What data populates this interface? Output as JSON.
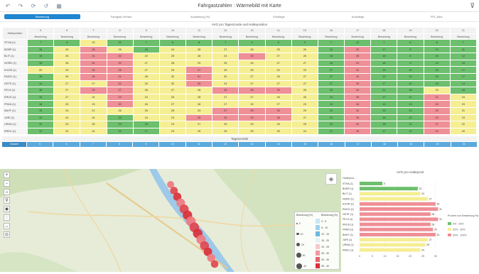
{
  "toolbar": {
    "title": "Fahrgastzahlen : Wärmebild mit Karte"
  },
  "tabs": [
    "Bewertung",
    "Fahrgast-Verlauf",
    "Auslastung (%)",
    "Einstiege",
    "Ausstiege",
    "FPL-Abw."
  ],
  "grid": {
    "title": "AVG pro Tageszonde und Halteposition",
    "corner_label": "Halteposition",
    "hours": [
      "5",
      "6",
      "7",
      "8",
      "9",
      "10",
      "11",
      "12",
      "13",
      "14",
      "15",
      "16",
      "17",
      "18",
      "19",
      "20",
      "21"
    ],
    "sub_label": "Bewertung",
    "rows": [
      {
        "label": "STHA (1)",
        "cells": [
          [
            "7",
            "g"
          ],
          [
            "6",
            "g"
          ],
          [
            "23",
            "y"
          ],
          [
            "21",
            "g"
          ],
          [
            "7",
            "g"
          ],
          [
            "8",
            "g"
          ],
          [
            "8",
            "g"
          ],
          [
            "7",
            "g"
          ],
          [
            "9",
            "g"
          ],
          [
            "8",
            "g"
          ],
          [
            "9",
            "g"
          ],
          [
            "7",
            "g"
          ],
          [
            "12",
            "g"
          ],
          [
            "7",
            "g"
          ],
          [
            "6",
            "g"
          ],
          [
            "8",
            "g"
          ],
          [
            "7",
            "g"
          ]
        ]
      },
      {
        "label": "BOBP (1)",
        "cells": [
          [
            "16",
            "g"
          ],
          [
            "29",
            "y"
          ],
          [
            "28",
            "r"
          ],
          [
            "26",
            "y"
          ],
          [
            "18",
            "g"
          ],
          [
            "24",
            "y"
          ],
          [
            "28",
            "y"
          ],
          [
            "27",
            "y"
          ],
          [
            "26",
            "y"
          ],
          [
            "25",
            "y"
          ],
          [
            "26",
            "y"
          ],
          [
            "10",
            "g"
          ],
          [
            "32",
            "r"
          ],
          [
            "17",
            "g"
          ],
          [
            "6",
            "g"
          ],
          [
            "13",
            "g"
          ],
          [
            "11",
            "g"
          ]
        ]
      },
      {
        "label": "BLIT (1)",
        "cells": [
          [
            "15",
            "g"
          ],
          [
            "25",
            "y"
          ],
          [
            "31",
            "r"
          ],
          [
            "32",
            "r"
          ],
          [
            "22",
            "y"
          ],
          [
            "25",
            "y"
          ],
          [
            "28",
            "y"
          ],
          [
            "24",
            "y"
          ],
          [
            "33",
            "r"
          ],
          [
            "27",
            "y"
          ],
          [
            "28",
            "y"
          ],
          [
            "16",
            "g"
          ],
          [
            "28",
            "r"
          ],
          [
            "18",
            "g"
          ],
          [
            "8",
            "g"
          ],
          [
            "16",
            "g"
          ],
          [
            "12",
            "g"
          ]
        ]
      },
      {
        "label": "NORD (1)",
        "cells": [
          [
            "15",
            "g"
          ],
          [
            "28",
            "y"
          ],
          [
            "31",
            "r"
          ],
          [
            "32",
            "r"
          ],
          [
            "27",
            "y"
          ],
          [
            "28",
            "y"
          ],
          [
            "29",
            "y"
          ],
          [
            "25",
            "y"
          ],
          [
            "26",
            "y"
          ],
          [
            "27",
            "y"
          ],
          [
            "27",
            "y"
          ],
          [
            "15",
            "g"
          ],
          [
            "31",
            "r"
          ],
          [
            "18",
            "g"
          ],
          [
            "9",
            "g"
          ],
          [
            "19",
            "g"
          ],
          [
            "15",
            "g"
          ]
        ]
      },
      {
        "label": "KOOR (1)",
        "cells": [
          [
            "20",
            "y"
          ],
          [
            "29",
            "y"
          ],
          [
            "33",
            "r"
          ],
          [
            "28",
            "r"
          ],
          [
            "27",
            "y"
          ],
          [
            "26",
            "y"
          ],
          [
            "27",
            "r"
          ],
          [
            "28",
            "y"
          ],
          [
            "28",
            "y"
          ],
          [
            "32",
            "y"
          ],
          [
            "23",
            "y"
          ],
          [
            "27",
            "g"
          ],
          [
            "31",
            "r"
          ],
          [
            "18",
            "g"
          ],
          [
            "10",
            "g"
          ],
          [
            "18",
            "g"
          ],
          [
            "17",
            "g"
          ]
        ]
      },
      {
        "label": "RUDO (1)",
        "cells": [
          [
            "18",
            "g"
          ],
          [
            "30",
            "y"
          ],
          [
            "33",
            "r"
          ],
          [
            "31",
            "r"
          ],
          [
            "28",
            "y"
          ],
          [
            "32",
            "y"
          ],
          [
            "31",
            "r"
          ],
          [
            "30",
            "y"
          ],
          [
            "27",
            "y"
          ],
          [
            "26",
            "y"
          ],
          [
            "27",
            "y"
          ],
          [
            "27",
            "g"
          ],
          [
            "33",
            "r"
          ],
          [
            "19",
            "g"
          ],
          [
            "10",
            "g"
          ],
          [
            "25",
            "g"
          ],
          [
            "17",
            "g"
          ]
        ]
      },
      {
        "label": "GETE (1)",
        "cells": [
          [
            "14",
            "g"
          ],
          [
            "27",
            "y"
          ],
          [
            "27",
            "y"
          ],
          [
            "32",
            "r"
          ],
          [
            "26",
            "y"
          ],
          [
            "32",
            "y"
          ],
          [
            "33",
            "r"
          ],
          [
            "24",
            "y"
          ],
          [
            "27",
            "y"
          ],
          [
            "27",
            "y"
          ],
          [
            "27",
            "y"
          ],
          [
            "27",
            "g"
          ],
          [
            "33",
            "r"
          ],
          [
            "17",
            "g"
          ],
          [
            "10",
            "g"
          ],
          [
            "18",
            "g"
          ],
          [
            "14",
            "g"
          ]
        ]
      },
      {
        "label": "FELS (1)",
        "cells": [
          [
            "18",
            "g"
          ],
          [
            "27",
            "y"
          ],
          [
            "33",
            "r"
          ],
          [
            "27",
            "r"
          ],
          [
            "28",
            "y"
          ],
          [
            "27",
            "y"
          ],
          [
            "28",
            "y"
          ],
          [
            "33",
            "r"
          ],
          [
            "36",
            "r"
          ],
          [
            "33",
            "r"
          ],
          [
            "26",
            "y"
          ],
          [
            "25",
            "g"
          ],
          [
            "34",
            "r"
          ],
          [
            "21",
            "g"
          ],
          [
            "16",
            "g"
          ],
          [
            "23",
            "y"
          ],
          [
            "18",
            "g"
          ]
        ]
      },
      {
        "label": "KRUS (1)",
        "cells": [
          [
            "16",
            "g"
          ],
          [
            "27",
            "y"
          ],
          [
            "24",
            "y"
          ],
          [
            "24",
            "r"
          ],
          [
            "24",
            "y"
          ],
          [
            "26",
            "y"
          ],
          [
            "28",
            "y"
          ],
          [
            "27",
            "y"
          ],
          [
            "27",
            "y"
          ],
          [
            "26",
            "y"
          ],
          [
            "26",
            "y"
          ],
          [
            "24",
            "g"
          ],
          [
            "33",
            "r"
          ],
          [
            "17",
            "g"
          ],
          [
            "11",
            "g"
          ],
          [
            "21",
            "r"
          ],
          [
            "24",
            "y"
          ]
        ]
      },
      {
        "label": "FRAN (1)",
        "cells": [
          [
            "18",
            "g"
          ],
          [
            "25",
            "y"
          ],
          [
            "23",
            "y"
          ],
          [
            "30",
            "r"
          ],
          [
            "26",
            "y"
          ],
          [
            "27",
            "y"
          ],
          [
            "28",
            "y"
          ],
          [
            "27",
            "y"
          ],
          [
            "30",
            "y"
          ],
          [
            "27",
            "y"
          ],
          [
            "23",
            "y"
          ],
          [
            "24",
            "g"
          ],
          [
            "34",
            "r"
          ],
          [
            "19",
            "g"
          ],
          [
            "13",
            "g"
          ],
          [
            "25",
            "r"
          ],
          [
            "23",
            "y"
          ]
        ]
      },
      {
        "label": "BAHT (1)",
        "cells": [
          [
            "15",
            "g"
          ],
          [
            "24",
            "y"
          ],
          [
            "21",
            "y"
          ],
          [
            "26",
            "y"
          ],
          [
            "26",
            "y"
          ],
          [
            "28",
            "y"
          ],
          [
            "23",
            "y"
          ],
          [
            "27",
            "r"
          ],
          [
            "28",
            "r"
          ],
          [
            "33",
            "r"
          ],
          [
            "29",
            "y"
          ],
          [
            "22",
            "g"
          ],
          [
            "31",
            "r"
          ],
          [
            "19",
            "g"
          ],
          [
            "14",
            "g"
          ],
          [
            "23",
            "r"
          ],
          [
            "21",
            "y"
          ]
        ]
      },
      {
        "label": "JURI (1)",
        "cells": [
          [
            "13",
            "g"
          ],
          [
            "24",
            "y"
          ],
          [
            "24",
            "y"
          ],
          [
            "23",
            "g"
          ],
          [
            "24",
            "y"
          ],
          [
            "23",
            "y"
          ],
          [
            "25",
            "r"
          ],
          [
            "24",
            "r"
          ],
          [
            "25",
            "r"
          ],
          [
            "28",
            "r"
          ],
          [
            "27",
            "y"
          ],
          [
            "23",
            "g"
          ],
          [
            "33",
            "r"
          ],
          [
            "18",
            "g"
          ],
          [
            "12",
            "g"
          ],
          [
            "22",
            "r"
          ],
          [
            "23",
            "y"
          ]
        ]
      },
      {
        "label": "URAN (1)",
        "cells": [
          [
            "13",
            "g"
          ],
          [
            "23",
            "y"
          ],
          [
            "25",
            "y"
          ],
          [
            "23",
            "g"
          ],
          [
            "18",
            "g"
          ],
          [
            "24",
            "y"
          ],
          [
            "27",
            "y"
          ],
          [
            "26",
            "y"
          ],
          [
            "25",
            "y"
          ],
          [
            "26",
            "y"
          ],
          [
            "25",
            "y"
          ],
          [
            "22",
            "g"
          ],
          [
            "34",
            "r"
          ],
          [
            "18",
            "g"
          ],
          [
            "12",
            "g"
          ],
          [
            "27",
            "r"
          ],
          [
            "22",
            "y"
          ]
        ]
      },
      {
        "label": "KREU (1)",
        "cells": [
          [
            "12",
            "g"
          ],
          [
            "22",
            "y"
          ],
          [
            "24",
            "y"
          ],
          [
            "22",
            "g"
          ],
          [
            "17",
            "g"
          ],
          [
            "23",
            "y"
          ],
          [
            "25",
            "y"
          ],
          [
            "25",
            "y"
          ],
          [
            "25",
            "y"
          ],
          [
            "25",
            "y"
          ],
          [
            "24",
            "y"
          ],
          [
            "21",
            "g"
          ],
          [
            "33",
            "r"
          ],
          [
            "17",
            "g"
          ],
          [
            "11",
            "g"
          ],
          [
            "24",
            "r"
          ],
          [
            "20",
            "y"
          ]
        ]
      }
    ]
  },
  "footer": {
    "title": "Tageszonde",
    "label": "Gesamt",
    "values": [
      "5",
      "6",
      "7",
      "8",
      "9",
      "10",
      "11",
      "12",
      "13",
      "14",
      "15",
      "16",
      "17",
      "18",
      "19",
      "20",
      "21"
    ]
  },
  "map": {
    "legend_title_a": "Besetzung (%)",
    "legend_title_b": "Besetzung (%)",
    "legend_size": [
      "0",
      "10",
      "20",
      "30",
      "40"
    ],
    "legend_color": [
      "0 - 5",
      "5 - 10",
      "10 - 15",
      "15 - 20",
      "20 - 25",
      "25 - 30",
      "30 - 35",
      "35 - 40"
    ]
  },
  "chart_data": {
    "type": "bar",
    "title": "AVG pro Halteposit",
    "ylabel": "Halteposi...",
    "categories": [
      "STHA (1)",
      "BOBP (1)",
      "BLIT (1)",
      "NORD (1)",
      "KOOR (1)",
      "RUDO (1)",
      "GETE (1)",
      "FELS (1)",
      "KRUS (1)",
      "FRAN (1)",
      "BAHT (1)",
      "JURI (1)",
      "URAN (1)",
      "KREU (1)"
    ],
    "values": [
      9,
      23,
      24,
      27,
      30,
      31,
      28,
      31,
      28,
      29,
      30,
      27,
      26,
      24
    ],
    "colors": [
      "#6cbf6c",
      "#6cbf6c",
      "#f5ee93",
      "#f5ee93",
      "#ef8f96",
      "#ef8f96",
      "#ef8f96",
      "#ef8f96",
      "#ef8f96",
      "#ef8f96",
      "#ef8f96",
      "#f5ee93",
      "#f5ee93",
      "#f5ee93"
    ],
    "xlim": [
      0,
      32
    ],
    "xticks": [
      "0",
      "5",
      "10",
      "15",
      "20",
      "25",
      "30"
    ],
    "legend": {
      "title": "Prozent von Bewertung Ra...",
      "items": [
        [
          "#6cbf6c",
          "0% - 20%"
        ],
        [
          "#f5ee93",
          "20% - 30%"
        ],
        [
          "#ef8f96",
          "30% - 100%"
        ]
      ]
    }
  }
}
